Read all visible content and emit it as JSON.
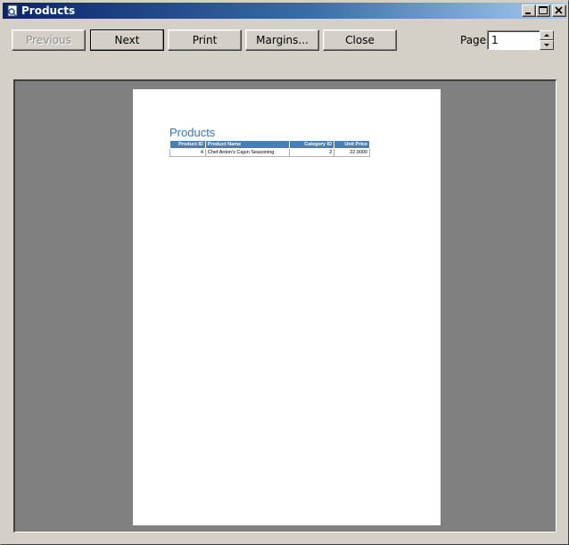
{
  "window": {
    "title": "Products",
    "icon": "report-preview-icon",
    "controls": [
      "minimize-icon",
      "maximize-icon",
      "close-icon"
    ]
  },
  "toolbar": {
    "previous_label": "Previous",
    "previous_enabled": false,
    "next_label": "Next",
    "print_label": "Print",
    "margins_label": "Margins...",
    "close_label": "Close",
    "page_label": "Page:",
    "page_value": "1"
  },
  "report": {
    "title": "Products",
    "columns": [
      "Product ID",
      "Product Name",
      "Category ID",
      "Unit Price"
    ],
    "rows": [
      [
        "4",
        "Chef Anton's Cajun Seasoning",
        "2",
        "22.0000"
      ]
    ]
  },
  "colors": {
    "title_bar_start": "#0a246a",
    "title_bar_end": "#a6caf0",
    "report_title": "#3a73b5",
    "table_header": "#4a7fb5",
    "preview_background": "#808080"
  }
}
